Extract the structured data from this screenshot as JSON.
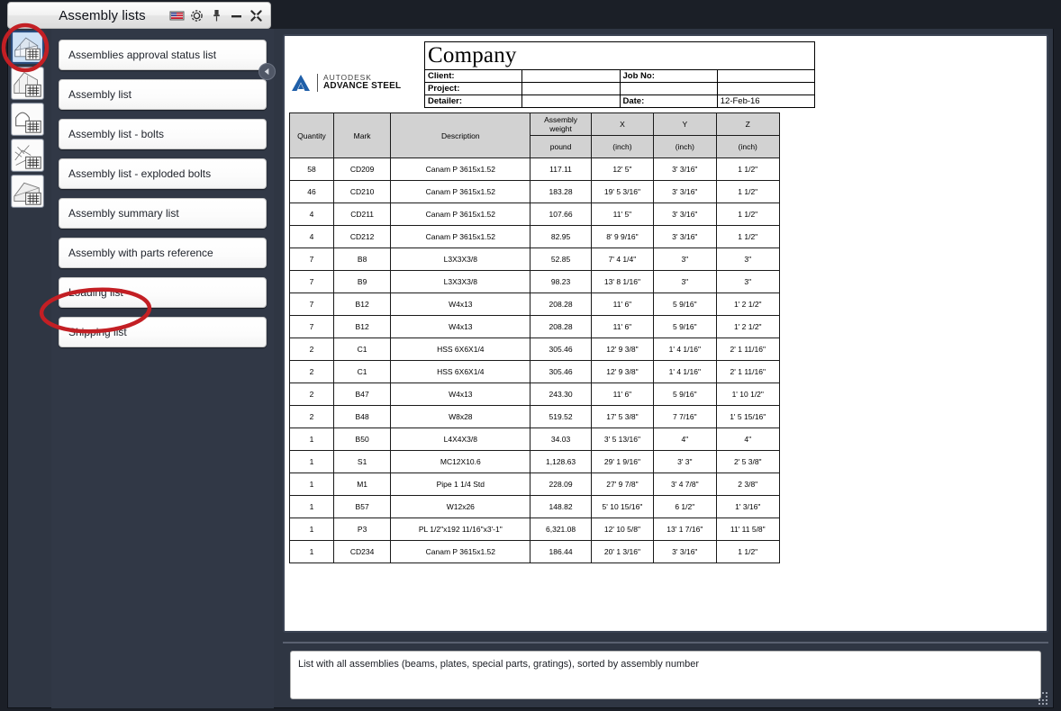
{
  "window": {
    "title": "Assembly lists",
    "titlebar_icons": [
      {
        "name": "language-flag-icon",
        "label": "Language"
      },
      {
        "name": "gear-icon",
        "label": "Settings"
      },
      {
        "name": "pin-icon",
        "label": "Pin"
      },
      {
        "name": "minimize-icon",
        "label": "Minimize"
      },
      {
        "name": "close-icon",
        "label": "Close"
      }
    ]
  },
  "rail": {
    "items": [
      {
        "name": "rail-assembly-lists",
        "label": "Assembly lists",
        "active": true
      },
      {
        "name": "rail-part-lists",
        "label": "Part lists",
        "active": false
      },
      {
        "name": "rail-bolt-lists",
        "label": "Bolt lists",
        "active": false
      },
      {
        "name": "rail-exploded-lists",
        "label": "Exploded lists",
        "active": false
      },
      {
        "name": "rail-structure-lists",
        "label": "Structure lists",
        "active": false
      }
    ]
  },
  "list": {
    "collapse_label": "◂",
    "items": [
      {
        "label": "Assemblies approval status list"
      },
      {
        "label": "Assembly list"
      },
      {
        "label": "Assembly list - bolts"
      },
      {
        "label": "Assembly list - exploded bolts"
      },
      {
        "label": "Assembly summary list"
      },
      {
        "label": "Assembly with parts reference"
      },
      {
        "label": "Loading list"
      },
      {
        "label": "Shipping list"
      }
    ]
  },
  "report": {
    "company": "Company",
    "logo": {
      "brand": "AUTODESK",
      "product": "ADVANCE STEEL"
    },
    "fields": {
      "client_label": "Client:",
      "client_value": "",
      "project_label": "Project:",
      "project_value": "",
      "detailer_label": "Detailer:",
      "detailer_value": "",
      "jobno_label": "Job No:",
      "jobno_value": "",
      "date_label": "Date:",
      "date_value": "12-Feb-16"
    },
    "table": {
      "headers": [
        "Quantity",
        "Mark",
        "Description",
        "Assembly weight",
        "X",
        "Y",
        "Z"
      ],
      "units": [
        "",
        "",
        "",
        "pound",
        "(inch)",
        "(inch)",
        "(inch)"
      ],
      "rows": [
        [
          "58",
          "CD209",
          "Canam P 3615x1.52",
          "117.11",
          "12' 5\"",
          "3' 3/16\"",
          "1 1/2\""
        ],
        [
          "46",
          "CD210",
          "Canam P 3615x1.52",
          "183.28",
          "19' 5 3/16\"",
          "3' 3/16\"",
          "1 1/2\""
        ],
        [
          "4",
          "CD211",
          "Canam P 3615x1.52",
          "107.66",
          "11' 5\"",
          "3' 3/16\"",
          "1 1/2\""
        ],
        [
          "4",
          "CD212",
          "Canam P 3615x1.52",
          "82.95",
          "8' 9 9/16\"",
          "3' 3/16\"",
          "1 1/2\""
        ],
        [
          "7",
          "B8",
          "L3X3X3/8",
          "52.85",
          "7' 4 1/4\"",
          "3\"",
          "3\""
        ],
        [
          "7",
          "B9",
          "L3X3X3/8",
          "98.23",
          "13' 8 1/16\"",
          "3\"",
          "3\""
        ],
        [
          "7",
          "B12",
          "W4x13",
          "208.28",
          "11' 6\"",
          "5 9/16\"",
          "1' 2 1/2\""
        ],
        [
          "7",
          "B12",
          "W4x13",
          "208.28",
          "11' 6\"",
          "5 9/16\"",
          "1' 2 1/2\""
        ],
        [
          "2",
          "C1",
          "HSS 6X6X1/4",
          "305.46",
          "12' 9 3/8\"",
          "1' 4 1/16\"",
          "2' 1 11/16\""
        ],
        [
          "2",
          "C1",
          "HSS 6X6X1/4",
          "305.46",
          "12' 9 3/8\"",
          "1' 4 1/16\"",
          "2' 1 11/16\""
        ],
        [
          "2",
          "B47",
          "W4x13",
          "243.30",
          "11' 6\"",
          "5 9/16\"",
          "1' 10 1/2\""
        ],
        [
          "2",
          "B48",
          "W8x28",
          "519.52",
          "17' 5 3/8\"",
          "7 7/16\"",
          "1' 5 15/16\""
        ],
        [
          "1",
          "B50",
          "L4X4X3/8",
          "34.03",
          "3' 5 13/16\"",
          "4\"",
          "4\""
        ],
        [
          "1",
          "S1",
          "MC12X10.6",
          "1,128.63",
          "29' 1 9/16\"",
          "3' 3\"",
          "2' 5 3/8\""
        ],
        [
          "1",
          "M1",
          "Pipe 1 1/4 Std",
          "228.09",
          "27' 9 7/8\"",
          "3' 4 7/8\"",
          "2 3/8\""
        ],
        [
          "1",
          "B57",
          "W12x26",
          "148.82",
          "5' 10 15/16\"",
          "6 1/2\"",
          "1' 3/16\""
        ],
        [
          "1",
          "P3",
          "PL 1/2\"x192 11/16\"x3'-1\"",
          "6,321.08",
          "12' 10 5/8\"",
          "13' 1 7/16\"",
          "11' 11 5/8\""
        ],
        [
          "1",
          "CD234",
          "Canam P 3615x1.52",
          "186.44",
          "20' 1 3/16\"",
          "3' 3/16\"",
          "1 1/2\""
        ]
      ]
    }
  },
  "description": {
    "text": "List with all assemblies (beams, plates, special parts, gratings), sorted by assembly number"
  },
  "colors": {
    "panel_bg": "#2f3643",
    "outer_bg": "#1b1f27",
    "annotation_red": "#c31f24",
    "accent_blue": "#2b4d7e",
    "autodesk_blue": "#1f5fa9",
    "table_header": "#d2d2d2"
  }
}
